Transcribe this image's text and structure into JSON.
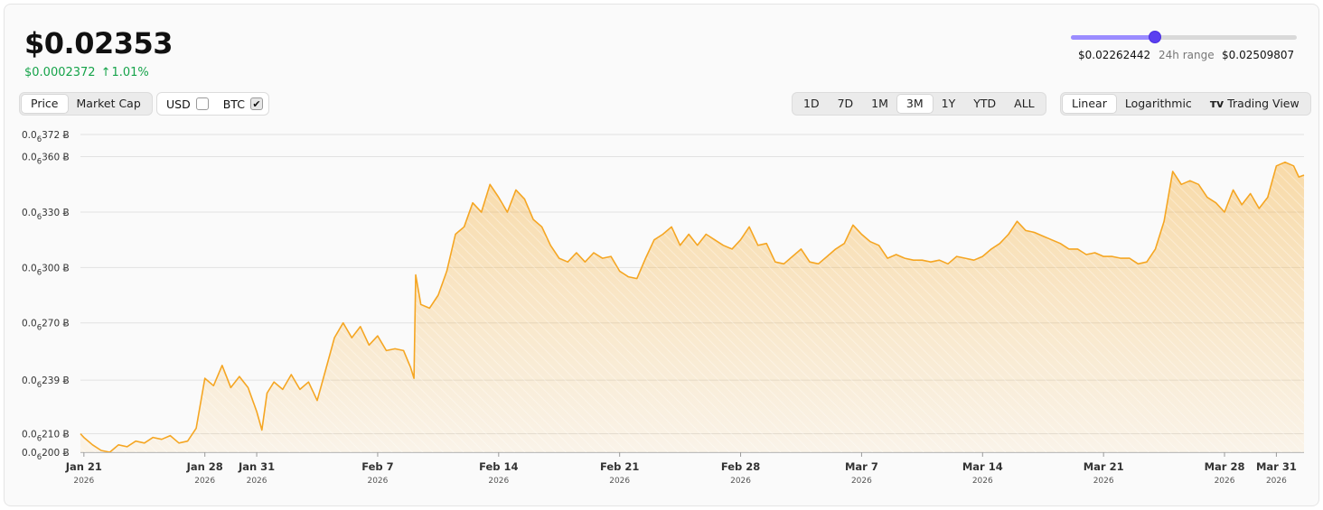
{
  "header": {
    "price": "$0.02353",
    "change_abs": "$0.0002372",
    "change_pct": "1.01%",
    "change_arrow": "↑"
  },
  "range24h": {
    "low": "$0.02262442",
    "label": "24h range",
    "high": "$0.02509807",
    "position": 0.37
  },
  "metric_toggle": {
    "price": "Price",
    "market_cap": "Market Cap",
    "active": "price"
  },
  "currency": {
    "usd": {
      "label": "USD",
      "checked": false
    },
    "btc": {
      "label": "BTC",
      "checked": true
    }
  },
  "timeframes": [
    "1D",
    "7D",
    "1M",
    "3M",
    "1Y",
    "YTD",
    "ALL"
  ],
  "timeframe_active": "3M",
  "scale_toggle": {
    "linear": "Linear",
    "log": "Logarithmic",
    "trading_view": "Trading View",
    "active": "linear"
  },
  "colors": {
    "line": "#f5a623",
    "up": "#16a34a",
    "accent": "#5b3ff0"
  },
  "chart_data": {
    "type": "area",
    "y_unit": "BTC (values ×10⁻⁸)",
    "y_ticks": [
      {
        "value": 200,
        "label": "0.0",
        "sub": "6",
        "tail": "200 Ƀ"
      },
      {
        "value": 210,
        "label": "0.0",
        "sub": "6",
        "tail": "210 Ƀ"
      },
      {
        "value": 239,
        "label": "0.0",
        "sub": "6",
        "tail": "239 Ƀ"
      },
      {
        "value": 270,
        "label": "0.0",
        "sub": "6",
        "tail": "270 Ƀ"
      },
      {
        "value": 300,
        "label": "0.0",
        "sub": "6",
        "tail": "300 Ƀ"
      },
      {
        "value": 330,
        "label": "0.0",
        "sub": "6",
        "tail": "330 Ƀ"
      },
      {
        "value": 360,
        "label": "0.0",
        "sub": "6",
        "tail": "360 Ƀ"
      },
      {
        "value": 372,
        "label": "0.0",
        "sub": "6",
        "tail": "372 Ƀ"
      }
    ],
    "ylim": [
      200,
      372
    ],
    "x_ticks": [
      {
        "day": 0,
        "label": "Jan 21",
        "year": "2026"
      },
      {
        "day": 7,
        "label": "Jan 28",
        "year": "2026"
      },
      {
        "day": 10,
        "label": "Jan 31",
        "year": "2026"
      },
      {
        "day": 17,
        "label": "Feb 7",
        "year": "2026"
      },
      {
        "day": 24,
        "label": "Feb 14",
        "year": "2026"
      },
      {
        "day": 31,
        "label": "Feb 21",
        "year": "2026"
      },
      {
        "day": 38,
        "label": "Feb 28",
        "year": "2026"
      },
      {
        "day": 45,
        "label": "Mar 7",
        "year": "2026"
      },
      {
        "day": 52,
        "label": "Mar 14",
        "year": "2026"
      },
      {
        "day": 59,
        "label": "Mar 21",
        "year": "2026"
      },
      {
        "day": 66,
        "label": "Mar 28",
        "year": "2026"
      },
      {
        "day": 69,
        "label": "Mar 31",
        "year": "2026"
      }
    ],
    "xlim": [
      -0.2,
      70.6
    ],
    "series": [
      {
        "points": [
          [
            -0.2,
            210
          ],
          [
            0,
            208
          ],
          [
            0.5,
            204
          ],
          [
            1,
            201
          ],
          [
            1.5,
            200
          ],
          [
            2,
            204
          ],
          [
            2.5,
            203
          ],
          [
            3,
            206
          ],
          [
            3.5,
            205
          ],
          [
            4,
            208
          ],
          [
            4.5,
            207
          ],
          [
            5,
            209
          ],
          [
            5.5,
            205
          ],
          [
            6,
            206
          ],
          [
            6.5,
            213
          ],
          [
            7,
            240
          ],
          [
            7.5,
            236
          ],
          [
            8,
            247
          ],
          [
            8.5,
            235
          ],
          [
            9,
            241
          ],
          [
            9.5,
            235
          ],
          [
            10,
            222
          ],
          [
            10.3,
            212
          ],
          [
            10.6,
            232
          ],
          [
            11,
            238
          ],
          [
            11.5,
            234
          ],
          [
            12,
            242
          ],
          [
            12.5,
            234
          ],
          [
            13,
            238
          ],
          [
            13.5,
            228
          ],
          [
            14,
            245
          ],
          [
            14.5,
            262
          ],
          [
            15,
            270
          ],
          [
            15.5,
            262
          ],
          [
            16,
            268
          ],
          [
            16.5,
            258
          ],
          [
            17,
            263
          ],
          [
            17.5,
            255
          ],
          [
            18,
            256
          ],
          [
            18.5,
            255
          ],
          [
            18.9,
            246
          ],
          [
            19.1,
            240
          ],
          [
            19.2,
            296
          ],
          [
            19.5,
            280
          ],
          [
            20,
            278
          ],
          [
            20.5,
            285
          ],
          [
            21,
            298
          ],
          [
            21.5,
            318
          ],
          [
            22,
            322
          ],
          [
            22.5,
            335
          ],
          [
            23,
            330
          ],
          [
            23.5,
            345
          ],
          [
            24,
            338
          ],
          [
            24.5,
            330
          ],
          [
            25,
            342
          ],
          [
            25.5,
            337
          ],
          [
            26,
            326
          ],
          [
            26.5,
            322
          ],
          [
            27,
            312
          ],
          [
            27.5,
            305
          ],
          [
            28,
            303
          ],
          [
            28.5,
            308
          ],
          [
            29,
            303
          ],
          [
            29.5,
            308
          ],
          [
            30,
            305
          ],
          [
            30.5,
            306
          ],
          [
            31,
            298
          ],
          [
            31.5,
            295
          ],
          [
            32,
            294
          ],
          [
            32.5,
            305
          ],
          [
            33,
            315
          ],
          [
            33.5,
            318
          ],
          [
            34,
            322
          ],
          [
            34.5,
            312
          ],
          [
            35,
            318
          ],
          [
            35.5,
            312
          ],
          [
            36,
            318
          ],
          [
            36.5,
            315
          ],
          [
            37,
            312
          ],
          [
            37.5,
            310
          ],
          [
            38,
            315
          ],
          [
            38.5,
            322
          ],
          [
            39,
            312
          ],
          [
            39.5,
            313
          ],
          [
            40,
            303
          ],
          [
            40.5,
            302
          ],
          [
            41,
            306
          ],
          [
            41.5,
            310
          ],
          [
            42,
            303
          ],
          [
            42.5,
            302
          ],
          [
            43,
            306
          ],
          [
            43.5,
            310
          ],
          [
            44,
            313
          ],
          [
            44.5,
            323
          ],
          [
            45,
            318
          ],
          [
            45.5,
            314
          ],
          [
            46,
            312
          ],
          [
            46.5,
            305
          ],
          [
            47,
            307
          ],
          [
            47.5,
            305
          ],
          [
            48,
            304
          ],
          [
            48.5,
            304
          ],
          [
            49,
            303
          ],
          [
            49.5,
            304
          ],
          [
            50,
            302
          ],
          [
            50.5,
            306
          ],
          [
            51,
            305
          ],
          [
            51.5,
            304
          ],
          [
            52,
            306
          ],
          [
            52.5,
            310
          ],
          [
            53,
            313
          ],
          [
            53.5,
            318
          ],
          [
            54,
            325
          ],
          [
            54.5,
            320
          ],
          [
            55,
            319
          ],
          [
            55.5,
            317
          ],
          [
            56,
            315
          ],
          [
            56.5,
            313
          ],
          [
            57,
            310
          ],
          [
            57.5,
            310
          ],
          [
            58,
            307
          ],
          [
            58.5,
            308
          ],
          [
            59,
            306
          ],
          [
            59.5,
            306
          ],
          [
            60,
            305
          ],
          [
            60.5,
            305
          ],
          [
            61,
            302
          ],
          [
            61.5,
            303
          ],
          [
            62,
            310
          ],
          [
            62.5,
            325
          ],
          [
            63,
            352
          ],
          [
            63.5,
            345
          ],
          [
            64,
            347
          ],
          [
            64.5,
            345
          ],
          [
            65,
            338
          ],
          [
            65.5,
            335
          ],
          [
            66,
            330
          ],
          [
            66.5,
            342
          ],
          [
            67,
            334
          ],
          [
            67.5,
            340
          ],
          [
            68,
            332
          ],
          [
            68.5,
            338
          ],
          [
            69,
            355
          ],
          [
            69.5,
            357
          ],
          [
            70,
            355
          ],
          [
            70.3,
            349
          ],
          [
            70.6,
            350
          ]
        ]
      }
    ]
  }
}
